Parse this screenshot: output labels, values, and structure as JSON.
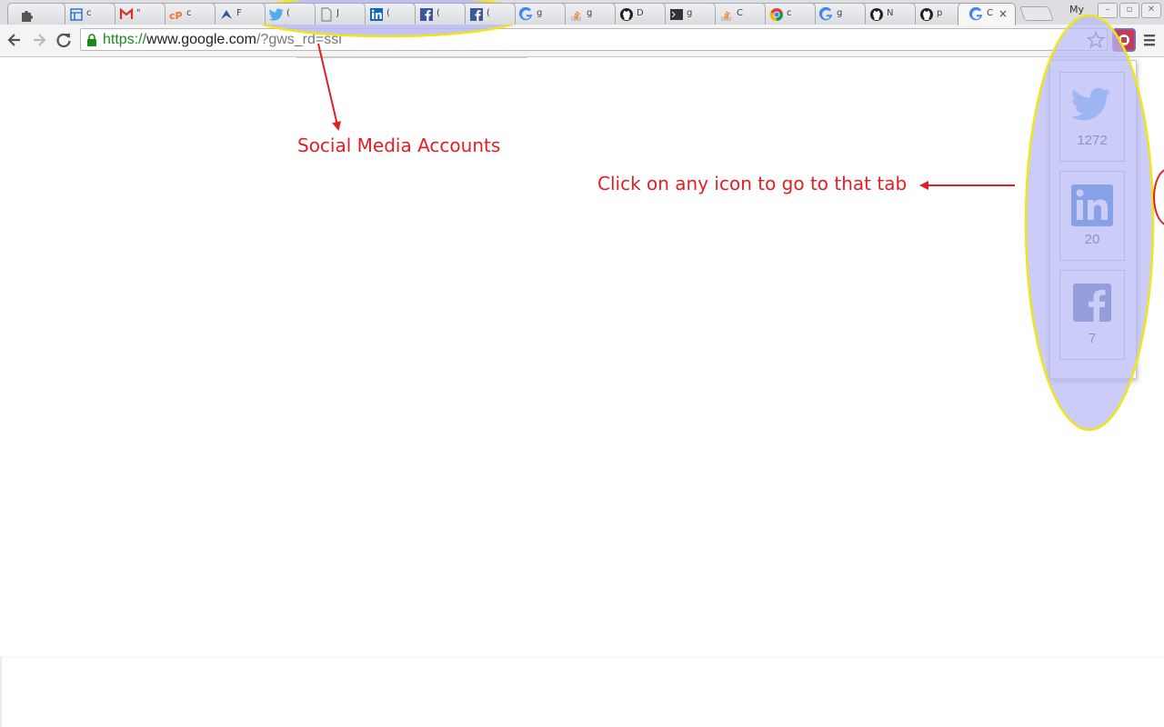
{
  "tabstrip": {
    "tabs": [
      {
        "icon": "puzzle-icon",
        "title": "",
        "highlight": false
      },
      {
        "icon": "window-layout-icon",
        "title": "c",
        "highlight": false
      },
      {
        "icon": "gmail-icon",
        "title": "\"",
        "highlight": false
      },
      {
        "icon": "cpanel-icon",
        "title": "c",
        "highlight": false
      },
      {
        "icon": "bird-icon",
        "title": "F",
        "highlight": false
      },
      {
        "icon": "twitter-icon",
        "title": "(",
        "highlight": true
      },
      {
        "icon": "page-icon",
        "title": "J",
        "highlight": true
      },
      {
        "icon": "linkedin-icon",
        "title": "(",
        "highlight": true
      },
      {
        "icon": "facebook-icon",
        "title": "(",
        "highlight": true
      },
      {
        "icon": "facebook-icon",
        "title": "(",
        "highlight": true
      },
      {
        "icon": "google-icon",
        "title": "g",
        "highlight": false
      },
      {
        "icon": "stackoverflow-icon",
        "title": "g",
        "highlight": false
      },
      {
        "icon": "github-icon",
        "title": "D",
        "highlight": false
      },
      {
        "icon": "terminal-icon",
        "title": "g",
        "highlight": false
      },
      {
        "icon": "stackoverflow-icon",
        "title": "C",
        "highlight": false
      },
      {
        "icon": "chrome-icon",
        "title": "c",
        "highlight": false
      },
      {
        "icon": "google-icon",
        "title": "g",
        "highlight": false
      },
      {
        "icon": "github-icon",
        "title": "N",
        "highlight": false
      },
      {
        "icon": "github-icon",
        "title": "p",
        "highlight": false
      },
      {
        "icon": "google-icon",
        "title": "C",
        "highlight": false,
        "active": true
      }
    ],
    "active_close": "×",
    "profile_label": "My"
  },
  "toolbar": {
    "url_scheme": "https://",
    "url_host": "www.google.com",
    "url_rest": "/?gws_rd=ssl"
  },
  "popup": {
    "items": [
      {
        "name": "twitter",
        "icon": "twitter-icon",
        "count": "1272",
        "color": "#55acee"
      },
      {
        "name": "linkedin",
        "icon": "linkedin-icon",
        "count": "20",
        "color": "#0a66c2"
      },
      {
        "name": "facebook",
        "icon": "facebook-icon",
        "count": "7",
        "color": "#3b5998"
      }
    ]
  },
  "annotations": {
    "social_label": "Social Media Accounts",
    "click_label": "Click on any icon to go to that tab",
    "color": "#e31e24",
    "highlight_fill": "#b8b8f5",
    "highlight_stroke": "#f0e51a"
  }
}
